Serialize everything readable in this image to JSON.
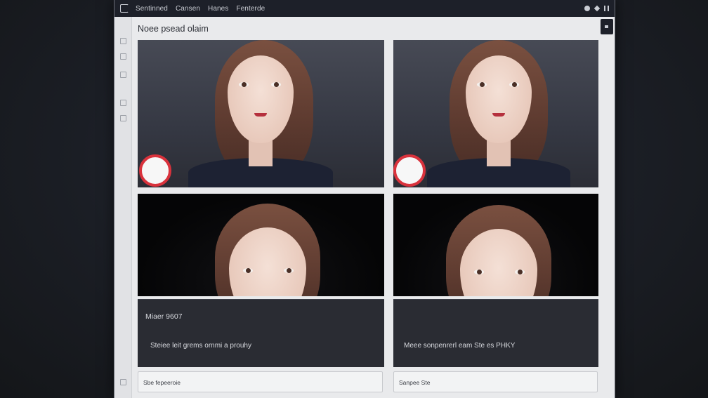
{
  "topbar": {
    "nav": [
      "Sentinned",
      "Cansen",
      "Hanes",
      "Fenterde"
    ]
  },
  "page": {
    "title": "Noee psead olaim"
  },
  "panels": {
    "left_info": {
      "heading": "Miaer 9607",
      "body": "Steiee leit grems ornmi a prouhy"
    },
    "right_info": {
      "body": "Meee sonpenrerl eam Ste es PHKY"
    },
    "left_field": "Sbe fepeeroie",
    "right_field": "Sanpee Ste"
  },
  "icons": {
    "topbar_right": [
      "globe-icon",
      "bell-icon",
      "pause-icon"
    ],
    "badge": "record-icon"
  },
  "colors": {
    "topbar": "#1d2029",
    "record_ring": "#d9323c",
    "info_panel": "#2a2c33"
  }
}
